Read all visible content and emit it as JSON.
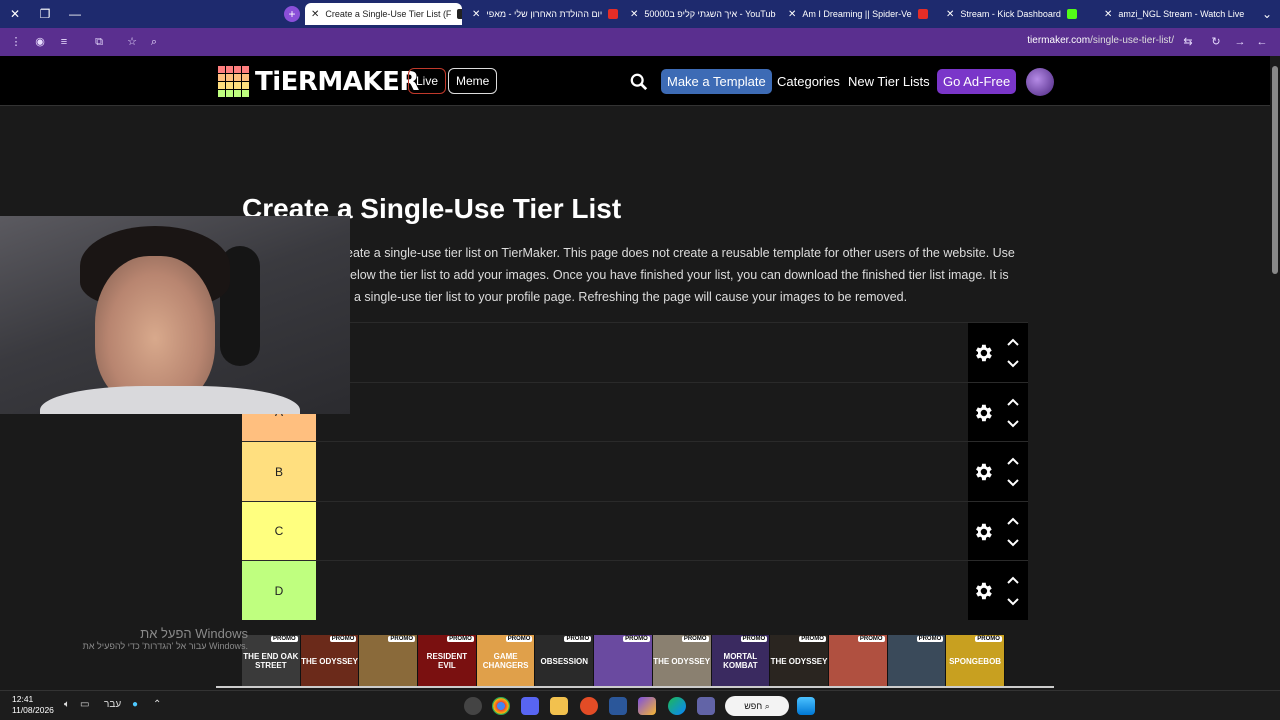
{
  "browser": {
    "tabs": [
      {
        "label": "Create a Single-Use Tier List (F",
        "active": true
      },
      {
        "label": "יום ההולדת האחרון שלי - מאפי",
        "active": false
      },
      {
        "label": "איך השגתי קליפ ב50000 - YouTube",
        "active": false
      },
      {
        "label": "Am I Dreaming || Spider-Ve",
        "active": false
      },
      {
        "label": "Stream - Kick Dashboard",
        "active": false
      },
      {
        "label": "amzi_NGL Stream - Watch Live",
        "active": false
      }
    ],
    "url_domain": "tiermaker.com",
    "url_path": "/single-use-tier-list/",
    "accent": "#5a2f8f"
  },
  "site": {
    "logo_text": "TiERMAKER",
    "live_label": "Live",
    "meme_label": "Meme",
    "make_template_label": "Make a Template",
    "categories_label": "Categories",
    "new_tier_lists_label": "New Tier Lists",
    "ad_free_label": "Go Ad-Free"
  },
  "page": {
    "title": "Create a Single-Use Tier List",
    "desc_line1": "eate a single-use tier list on TierMaker. This page does not create a reusable template for other users of the website. Use",
    "desc_line2": "elow the tier list to add your images. Once you have finished your list, you can download the finished tier list image. It is",
    "desc_line3": "a single-use tier list to your profile page. Refreshing the page will cause your images to be removed."
  },
  "tiers": [
    {
      "label": "",
      "color": "#ff7f7f"
    },
    {
      "label": "A",
      "color": "#ffbf7f"
    },
    {
      "label": "B",
      "color": "#ffdf7f"
    },
    {
      "label": "C",
      "color": "#ffff7f"
    },
    {
      "label": "D",
      "color": "#bfff7f"
    }
  ],
  "thumbnails": [
    {
      "text": "THE END OAK STREET",
      "color": "#3a3a3a",
      "promo": "PROMO"
    },
    {
      "text": "THE ODYSSEY",
      "color": "#6b2a1a",
      "promo": "PROMO"
    },
    {
      "text": "",
      "color": "#8a6a3a",
      "promo": "PROMO"
    },
    {
      "text": "RESIDENT EVIL",
      "color": "#7a1010",
      "promo": "PROMO"
    },
    {
      "text": "GAME CHANGERS",
      "color": "#e0a04a",
      "promo": "PROMO"
    },
    {
      "text": "OBSESSION",
      "color": "#2a2a2a",
      "promo": "PROMO"
    },
    {
      "text": "",
      "color": "#6a4aa0",
      "promo": "PROMO"
    },
    {
      "text": "THE ODYSSEY",
      "color": "#8a8070",
      "promo": "PROMO"
    },
    {
      "text": "MORTAL KOMBAT",
      "color": "#3a2a60",
      "promo": "PROMO"
    },
    {
      "text": "THE ODYSSEY",
      "color": "#2a2520",
      "promo": "PROMO"
    },
    {
      "text": "",
      "color": "#b05040",
      "promo": "PROMO"
    },
    {
      "text": "",
      "color": "#3a4a5a",
      "promo": "PROMO"
    },
    {
      "text": "SPONGEBOB",
      "color": "#c8a020",
      "promo": "PROMO"
    }
  ],
  "windows": {
    "activate_line1": "הפעל את Windows",
    "activate_line2": "עבור אל 'הגדרות' כדי להפעיל את Windows.",
    "time": "12:41",
    "date": "11/08/2026",
    "lang": "עבר",
    "search_label": "חפש"
  }
}
